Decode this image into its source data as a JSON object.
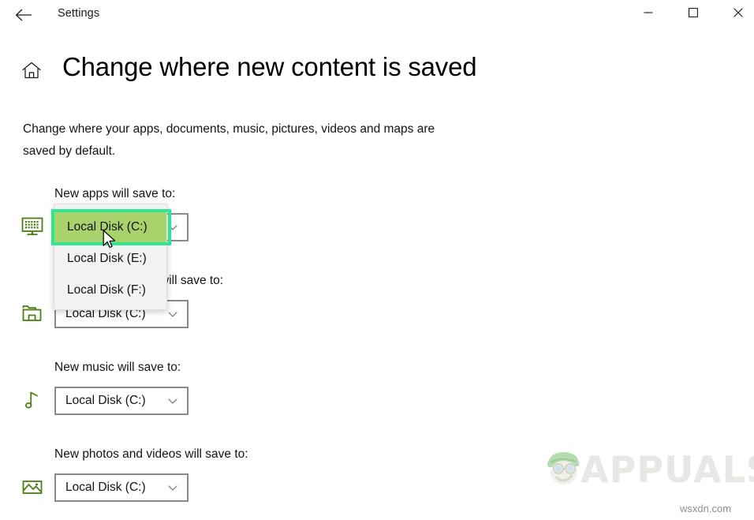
{
  "window": {
    "title": "Settings",
    "back_icon": "back-arrow-icon",
    "minimize_label": "–",
    "maximize_label": "□",
    "close_label": "✕"
  },
  "header": {
    "home_icon": "home-icon",
    "page_title": "Change where new content is saved"
  },
  "description": "Change where your apps, documents, music, pictures, videos and maps are saved by default.",
  "settings": [
    {
      "id": "apps",
      "label": "New apps will save to:",
      "icon": "monitor-apps-icon",
      "value": "Local Disk (C:)"
    },
    {
      "id": "documents",
      "label": "will save to:",
      "icon": "folder-documents-icon",
      "value": "Local Disk (C:)"
    },
    {
      "id": "music",
      "label": "New music will save to:",
      "icon": "music-note-icon",
      "value": "Local Disk (C:)"
    },
    {
      "id": "photos",
      "label": "New photos and videos will save to:",
      "icon": "picture-icon",
      "value": "Local Disk (C:)"
    }
  ],
  "dropdown": {
    "open_for": "apps",
    "options": [
      "Local Disk (C:)",
      "Local Disk (E:)",
      "Local Disk (F:)"
    ],
    "selected": "Local Disk (C:)"
  },
  "annotation": {
    "highlight_color": "#2ee68f",
    "highlight_target": "Local Disk (C:)"
  },
  "colors": {
    "icon_green": "#4f7d16",
    "selected_row": "#a9d16c",
    "combo_border": "#8b8b8b",
    "popup_background": "#f2f2f2"
  },
  "watermark": {
    "brand": "APPUALS",
    "site": "wsxdn.com"
  },
  "cursor": {
    "icon": "mouse-pointer-icon"
  }
}
